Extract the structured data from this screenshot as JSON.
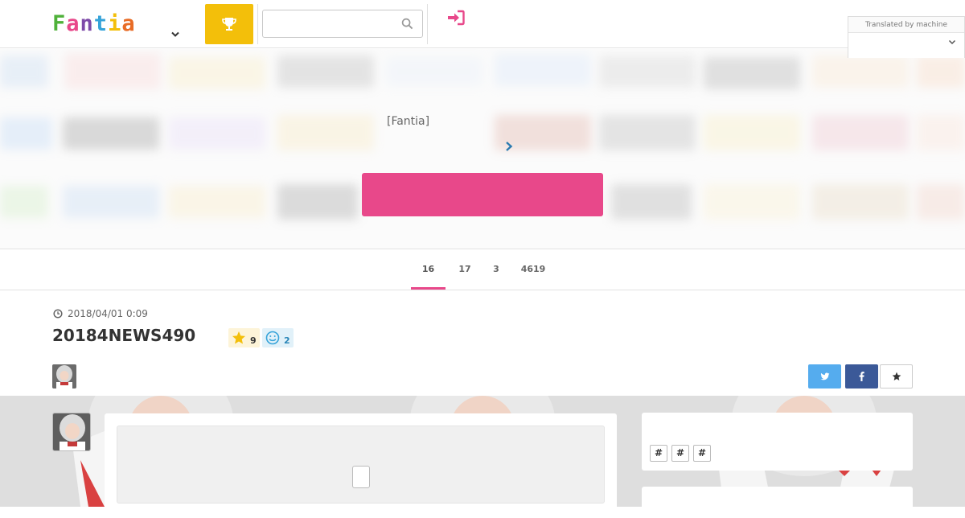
{
  "header": {
    "logo_letters": [
      "F",
      "a",
      "n",
      "t",
      "i",
      "a"
    ],
    "logo_colors": [
      "#4fb13a",
      "#e8488a",
      "#7d4aa8",
      "#36a3d9",
      "#f3bf0a",
      "#e86c26"
    ],
    "search": {
      "value": "",
      "placeholder": ""
    },
    "translate_label": "Translated by machine",
    "translate_value": "",
    "rank_color": "#f3bf0a",
    "login_color": "#e8488a"
  },
  "hero": {
    "label": "[Fantia]",
    "cta_label": "",
    "cta_color": "#e8488a"
  },
  "tabs": [
    {
      "label": "16",
      "active": true
    },
    {
      "label": "17",
      "active": false
    },
    {
      "label": "3",
      "active": false
    },
    {
      "label": "4619",
      "active": false
    }
  ],
  "post": {
    "date": "2018/04/01 0:09",
    "title": "20184NEWS490",
    "star_count": "9",
    "smile_count": "2",
    "tags": [
      "#",
      "#",
      "#"
    ]
  },
  "colors": {
    "accent": "#e8488a",
    "twitter": "#55acee",
    "facebook": "#3b5998",
    "star": "#f3bf0a",
    "smile": "#36a3d9"
  }
}
